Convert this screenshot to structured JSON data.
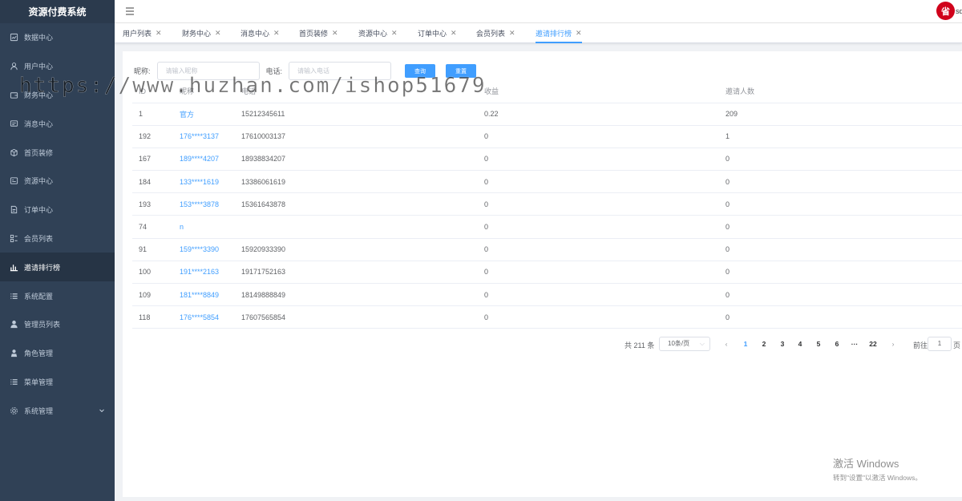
{
  "app": {
    "title": "资源付费系统"
  },
  "sidebar": {
    "items": [
      {
        "label": "数据中心",
        "icon": "dashboard-icon"
      },
      {
        "label": "用户中心",
        "icon": "user-icon"
      },
      {
        "label": "财务中心",
        "icon": "wallet-icon"
      },
      {
        "label": "消息中心",
        "icon": "message-icon"
      },
      {
        "label": "首页装修",
        "icon": "cube-icon"
      },
      {
        "label": "资源中心",
        "icon": "resource-icon"
      },
      {
        "label": "订单中心",
        "icon": "document-icon"
      },
      {
        "label": "会员列表",
        "icon": "list-grid-icon"
      },
      {
        "label": "邀请排行榜",
        "icon": "bar-chart-icon"
      },
      {
        "label": "系统配置",
        "icon": "list-icon"
      },
      {
        "label": "管理员列表",
        "icon": "person-icon"
      },
      {
        "label": "角色管理",
        "icon": "role-icon"
      },
      {
        "label": "菜单管理",
        "icon": "menu-list-icon"
      },
      {
        "label": "系统管理",
        "icon": "gear-icon"
      }
    ],
    "active_index": 8
  },
  "navbar": {
    "avatar_text": "省",
    "username": "sq"
  },
  "tags": [
    {
      "label": "用户列表",
      "close": "✕"
    },
    {
      "label": "财务中心",
      "close": "✕"
    },
    {
      "label": "消息中心",
      "close": "✕"
    },
    {
      "label": "首页装修",
      "close": "✕"
    },
    {
      "label": "资源中心",
      "close": "✕"
    },
    {
      "label": "订单中心",
      "close": "✕"
    },
    {
      "label": "会员列表",
      "close": "✕"
    },
    {
      "label": "邀请排行榜",
      "close": "✕"
    }
  ],
  "search": {
    "nickname_label": "昵称:",
    "nickname_placeholder": "请输入昵称",
    "phone_label": "电话:",
    "phone_placeholder": "请输入电话",
    "query_button": "查询",
    "reset_button": "重置"
  },
  "table": {
    "headers": [
      "ID",
      "昵称",
      "电话",
      "收益",
      "邀请人数"
    ],
    "rows": [
      [
        "1",
        "官方",
        "15212345611",
        "0.22",
        "209"
      ],
      [
        "192",
        "176****3137",
        "17610003137",
        "0",
        "1"
      ],
      [
        "167",
        "189****4207",
        "18938834207",
        "0",
        "0"
      ],
      [
        "184",
        "133****1619",
        "13386061619",
        "0",
        "0"
      ],
      [
        "193",
        "153****3878",
        "15361643878",
        "0",
        "0"
      ],
      [
        "74",
        "n",
        "",
        "0",
        "0"
      ],
      [
        "91",
        "159****3390",
        "15920933390",
        "0",
        "0"
      ],
      [
        "100",
        "191****2163",
        "19171752163",
        "0",
        "0"
      ],
      [
        "109",
        "181****8849",
        "18149888849",
        "0",
        "0"
      ],
      [
        "118",
        "176****5854",
        "17607565854",
        "0",
        "0"
      ]
    ]
  },
  "pagination": {
    "total_text": "共 211 条",
    "page_size": "10条/页",
    "prev": "‹",
    "pages": [
      "1",
      "2",
      "3",
      "4",
      "5",
      "6",
      "···",
      "22"
    ],
    "next": "›",
    "current": "1",
    "goto_label": "前往",
    "goto_value": "1",
    "goto_unit": "页"
  },
  "overlay": {
    "watermark": "https://www.huzhan.com/ishop51679",
    "activate_title": "激活 Windows",
    "activate_sub": "转到\"设置\"以激活 Windows。"
  }
}
